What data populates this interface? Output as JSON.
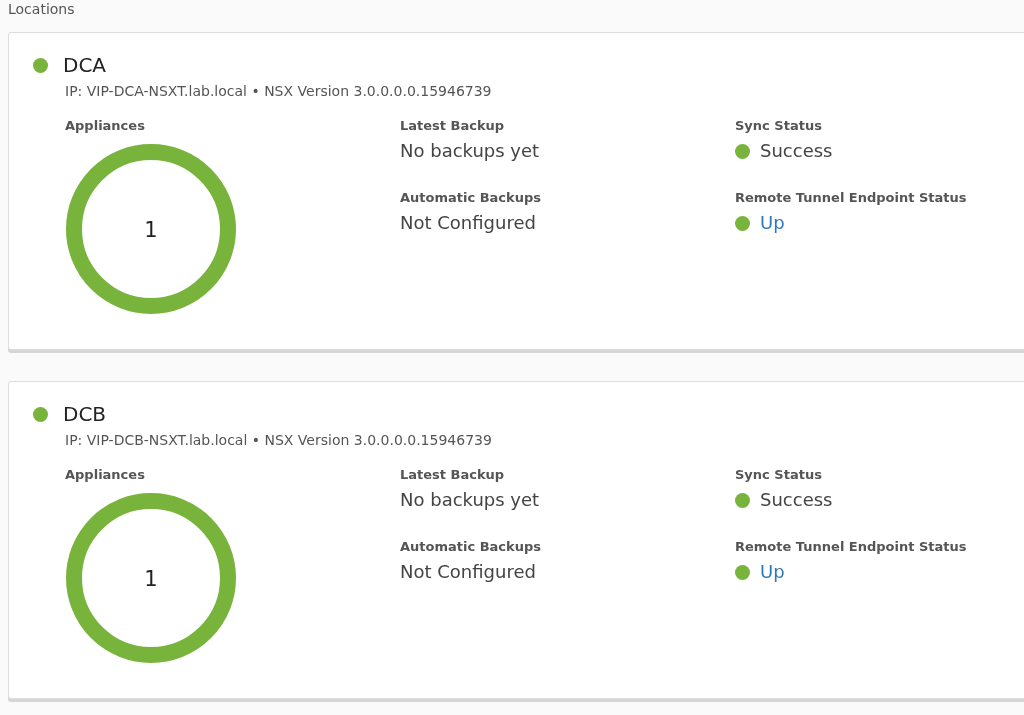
{
  "title": "Locations",
  "locations": [
    {
      "name": "DCA",
      "color": "#78b33c",
      "details": "IP: VIP-DCA-NSXT.lab.local • NSX Version 3.0.0.0.0.15946739",
      "appliances": {
        "label": "Appliances",
        "count": "1"
      },
      "fields": [
        {
          "label": "Latest Backup",
          "value": "No backups yet",
          "kind": "text"
        },
        {
          "label": "Sync Status",
          "value": "Success",
          "kind": "status",
          "color": "#78b33c"
        },
        {
          "label": "Automatic Backups",
          "value": "Not Configured",
          "kind": "text"
        },
        {
          "label": "Remote Tunnel Endpoint Status",
          "value": "Up",
          "kind": "link",
          "color": "#78b33c"
        }
      ]
    },
    {
      "name": "DCB",
      "color": "#78b33c",
      "details": "IP: VIP-DCB-NSXT.lab.local • NSX Version 3.0.0.0.0.15946739",
      "appliances": {
        "label": "Appliances",
        "count": "1"
      },
      "fields": [
        {
          "label": "Latest Backup",
          "value": "No backups yet",
          "kind": "text"
        },
        {
          "label": "Sync Status",
          "value": "Success",
          "kind": "status",
          "color": "#78b33c"
        },
        {
          "label": "Automatic Backups",
          "value": "Not Configured",
          "kind": "text"
        },
        {
          "label": "Remote Tunnel Endpoint Status",
          "value": "Up",
          "kind": "link",
          "color": "#78b33c"
        }
      ]
    }
  ]
}
